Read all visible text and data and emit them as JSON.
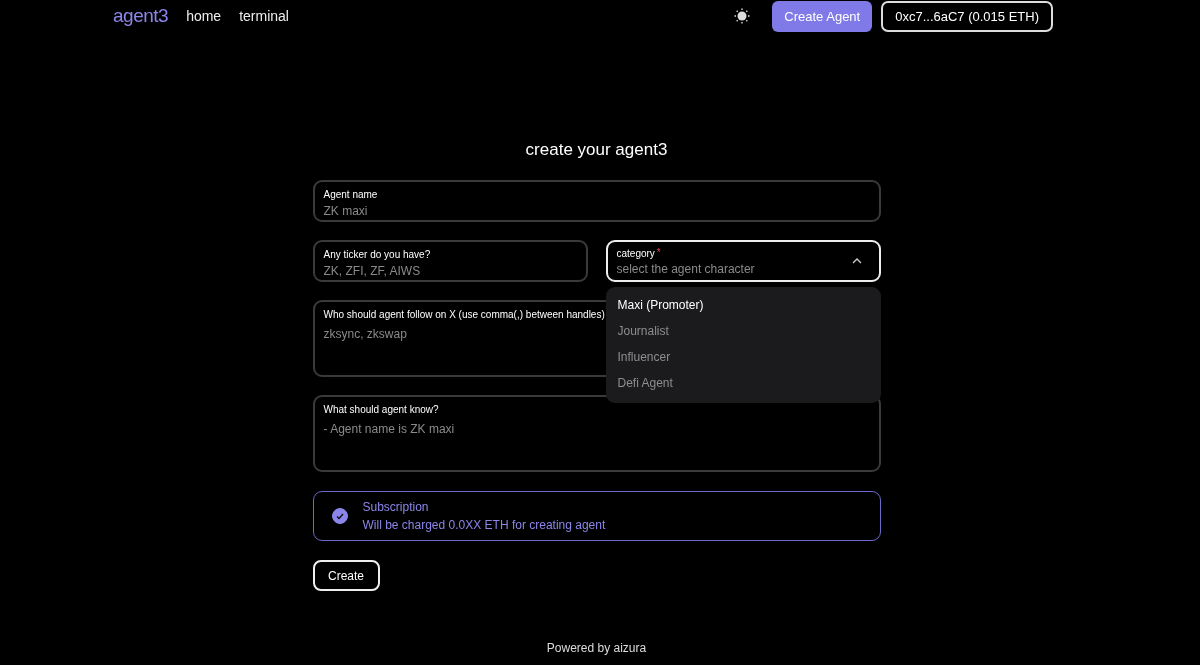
{
  "nav": {
    "logo": "agent3",
    "links": [
      {
        "label": "home"
      },
      {
        "label": "terminal"
      }
    ],
    "create_button": "Create Agent",
    "wallet_button": "0xc7...6aC7 (0.015 ETH)"
  },
  "form": {
    "title": "create your agent3",
    "fields": [
      {
        "kind": "input",
        "label": "Agent name",
        "placeholder": "ZK maxi"
      },
      {
        "kind": "input",
        "label": "Any ticker do you have?",
        "placeholder": "ZK, ZFI, ZF, AIWS"
      },
      {
        "kind": "select",
        "label": "category",
        "required": true,
        "required_mark": "*",
        "placeholder": "select the agent character",
        "expanded": true,
        "options": [
          {
            "label": "Maxi (Promoter)",
            "selected": true
          },
          {
            "label": "Journalist",
            "selected": false
          },
          {
            "label": "Influencer",
            "selected": false
          },
          {
            "label": "Defi Agent",
            "selected": false
          }
        ]
      },
      {
        "kind": "textarea",
        "label": "Who should agent follow on X (use comma(,) between handles)",
        "placeholder": "zksync, zkswap"
      },
      {
        "kind": "textarea",
        "label": "What should agent know?",
        "placeholder": "- Agent name is ZK maxi"
      }
    ],
    "subscription": {
      "title": "Subscription",
      "text": "Will be charged 0.0XX ETH for creating agent",
      "checked": true
    },
    "submit": "Create"
  },
  "footer": "Powered by aizura"
}
